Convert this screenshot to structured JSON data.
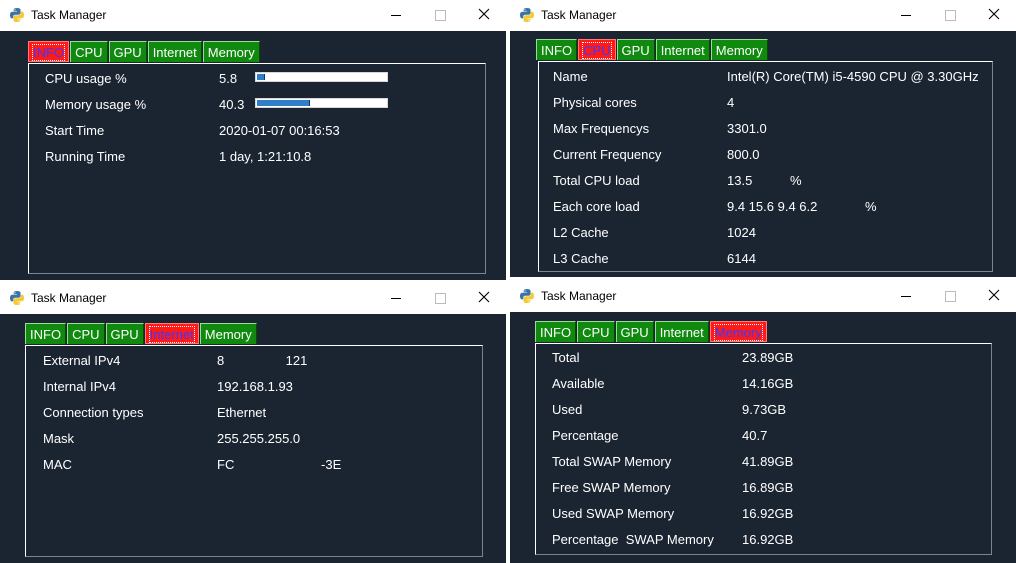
{
  "windows": [
    {
      "title": "Task Manager",
      "tabs": [
        "INFO",
        "CPU",
        "GPU",
        "Internet",
        "Memory"
      ],
      "active_tab": "INFO",
      "rows": [
        {
          "label": "CPU usage %",
          "value": "5.8"
        },
        {
          "label": "Memory usage %",
          "value": "40.3"
        },
        {
          "label": "Start Time",
          "value": "2020-01-07 00:16:53"
        },
        {
          "label": "Running Time",
          "value": "1 day, 1:21:10.8"
        }
      ],
      "progress": {
        "cpu": 0.058,
        "memory": 0.403
      }
    },
    {
      "title": "Task Manager",
      "tabs": [
        "INFO",
        "CPU",
        "GPU",
        "Internet",
        "Memory"
      ],
      "active_tab": "CPU",
      "rows": [
        {
          "label": "Name",
          "value": "Intel(R) Core(TM) i5-4590 CPU @ 3.30GHz"
        },
        {
          "label": "Physical cores",
          "value": "4"
        },
        {
          "label": "Max Frequencys",
          "value": "3301.0"
        },
        {
          "label": "Current Frequency",
          "value": "800.0"
        },
        {
          "label": "Total CPU load",
          "value": "13.5",
          "unit": "%"
        },
        {
          "label": "Each core load",
          "value": "9.4 15.6 9.4 6.2",
          "unit": "%"
        },
        {
          "label": "L2 Cache",
          "value": "1024"
        },
        {
          "label": "L3 Cache",
          "value": "6144"
        }
      ]
    },
    {
      "title": "Task Manager",
      "tabs": [
        "INFO",
        "CPU",
        "GPU",
        "Internet",
        "Memory"
      ],
      "active_tab": "Internet",
      "rows": [
        {
          "label": "External IPv4",
          "value": "8                 121"
        },
        {
          "label": "Internal IPv4",
          "value": "192.168.1.93"
        },
        {
          "label": "Connection types",
          "value": "Ethernet"
        },
        {
          "label": "Mask",
          "value": "255.255.255.0"
        },
        {
          "label": "MAC",
          "value": "FC                        -3E"
        }
      ]
    },
    {
      "title": "Task Manager",
      "tabs": [
        "INFO",
        "CPU",
        "GPU",
        "Internet",
        "Memory"
      ],
      "active_tab": "Memory",
      "rows": [
        {
          "label": "Total",
          "value": "23.89GB"
        },
        {
          "label": "Available",
          "value": "14.16GB"
        },
        {
          "label": "Used",
          "value": "9.73GB"
        },
        {
          "label": "Percentage",
          "value": "40.7"
        },
        {
          "label": "Total SWAP Memory",
          "value": "41.89GB"
        },
        {
          "label": "Free SWAP Memory",
          "value": "16.89GB"
        },
        {
          "label": "Used SWAP Memory",
          "value": "16.92GB"
        },
        {
          "label": "Percentage  SWAP Memory",
          "value": "16.92GB"
        }
      ]
    }
  ]
}
